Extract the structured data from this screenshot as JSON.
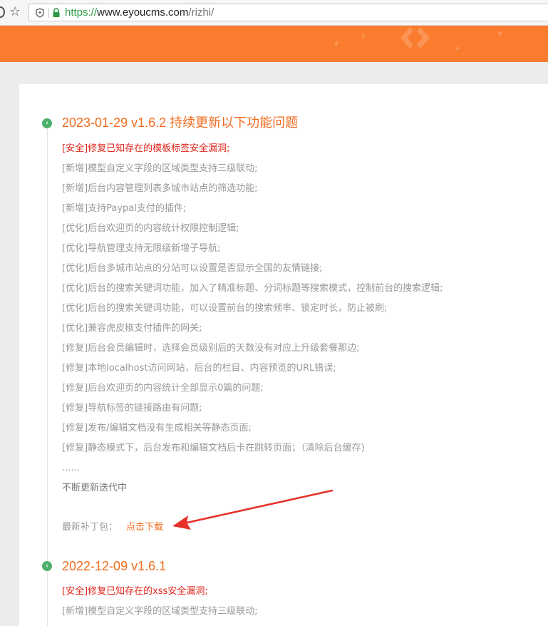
{
  "browser": {
    "url_scheme": "https://",
    "url_host": "www.eyoucms.com",
    "url_path": "/rizhi/",
    "icons": [
      "shield-icon",
      "lock-icon",
      "star-icon"
    ]
  },
  "banner": {
    "color": "#fb7c2e"
  },
  "releases": [
    {
      "title": "2023-01-29 v1.6.2 持续更新以下功能问题",
      "items": [
        "[安全]修复已知存在的模板标签安全漏洞;",
        "[新增]模型自定义字段的区域类型支持三级联动;",
        "[新增]后台内容管理列表多城市站点的筛选功能;",
        "[新增]支持Paypal支付的插件;",
        "[优化]后台欢迎页的内容统计权限控制逻辑;",
        "[优化]导航管理支持无限级新增子导航;",
        "[优化]后台多城市站点的分站可以设置是否显示全国的友情链接;",
        "[优化]后台的搜索关键词功能，加入了精准标题、分词标题等搜索模式，控制前台的搜索逻辑;",
        "[优化]后台的搜索关键词功能，可以设置前台的搜索频率、锁定时长，防止被刷;",
        "[优化]兼容虎皮椒支付插件的网关;",
        "[修复]后台会员编辑时，选择会员级别后的天数没有对应上升级套餐那边;",
        "[修复]本地localhost访问网站，后台的栏目、内容预览的URL错误;",
        "[修复]后台欢迎页的内容统计全部显示0篇的问题;",
        "[修复]导航标签的链接路由有问题;",
        "[修复]发布/编辑文档没有生成相关等静态页面;",
        "[修复]静态模式下，后台发布和编辑文档后卡在跳转页面；（清除后台缓存)"
      ],
      "ellipsis": "......",
      "ongoing": "不断更新迭代中",
      "patch_label": "最新补丁包：",
      "patch_link": "点击下载"
    },
    {
      "title": "2022-12-09 v1.6.1",
      "items": [
        "[安全]修复已知存在的xss安全漏洞;",
        "[新增]模型自定义字段的区域类型支持三级联动;"
      ]
    }
  ],
  "colors": {
    "accent": "#f26b1d",
    "security": "#e0251b",
    "timeline_dot": "#4fb06c",
    "annotation_arrow": "#e8302a"
  }
}
